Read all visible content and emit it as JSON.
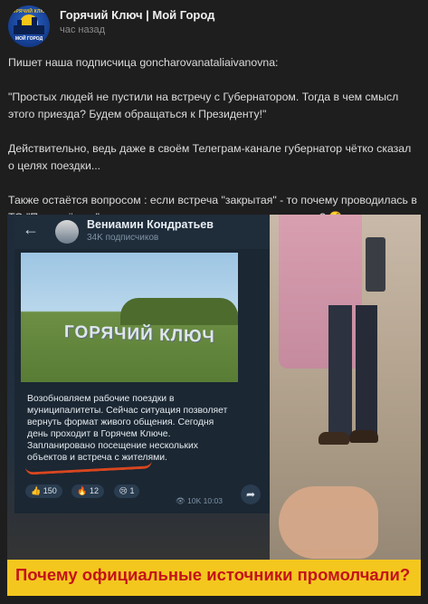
{
  "post": {
    "channel_name": "Горячий Ключ | Мой Город",
    "timestamp": "час назад",
    "avatar_text_top": "ГОРЯЧИЙ КЛЮЧ",
    "avatar_text_bottom": "МОЙ ГОРОД",
    "more_icon": "dots-icon",
    "paragraphs": [
      "Пишет наша подписчица goncharovanataliaivanovna:",
      "\"Простых людей не пустили на встречу с Губернатором. Тогда в чем смысл этого приезда? Будем обращаться к Президенту!\"",
      "Действительно, ведь даже в своём Телеграм-канале губернатор чётко сказал о целях поездки...",
      "Также остаётся вопросом : если встреча \"закрытая\" - то почему проводилась в ТО \"Перекрёсток\" , а не в здании администрации, например? 🤨"
    ]
  },
  "telegram_screenshot": {
    "back_icon": "←",
    "channel_name": "Вениамин Кондратьев",
    "subscribers": "34K подписчиков",
    "photo_sign": "ГОРЯЧИЙ КЛЮЧ",
    "message": "Возобновляем рабочие поездки в муниципалитеты. Сейчас ситуация позволяет вернуть формат живого общения. Сегодня день проходит в Горячем Ключе. Запланировано посещение нескольких объектов и встреча с жителями.",
    "reactions": [
      {
        "emoji": "👍",
        "count": "150"
      },
      {
        "emoji": "🔥",
        "count": "12"
      },
      {
        "emoji": "😢",
        "count": "1"
      }
    ],
    "views": "👁 10K",
    "time": "10:03",
    "share_icon": "➦"
  },
  "banner": {
    "text": "Почему официальные источники промолчали?",
    "background": "#f3c71e",
    "text_color": "#c4121b"
  }
}
